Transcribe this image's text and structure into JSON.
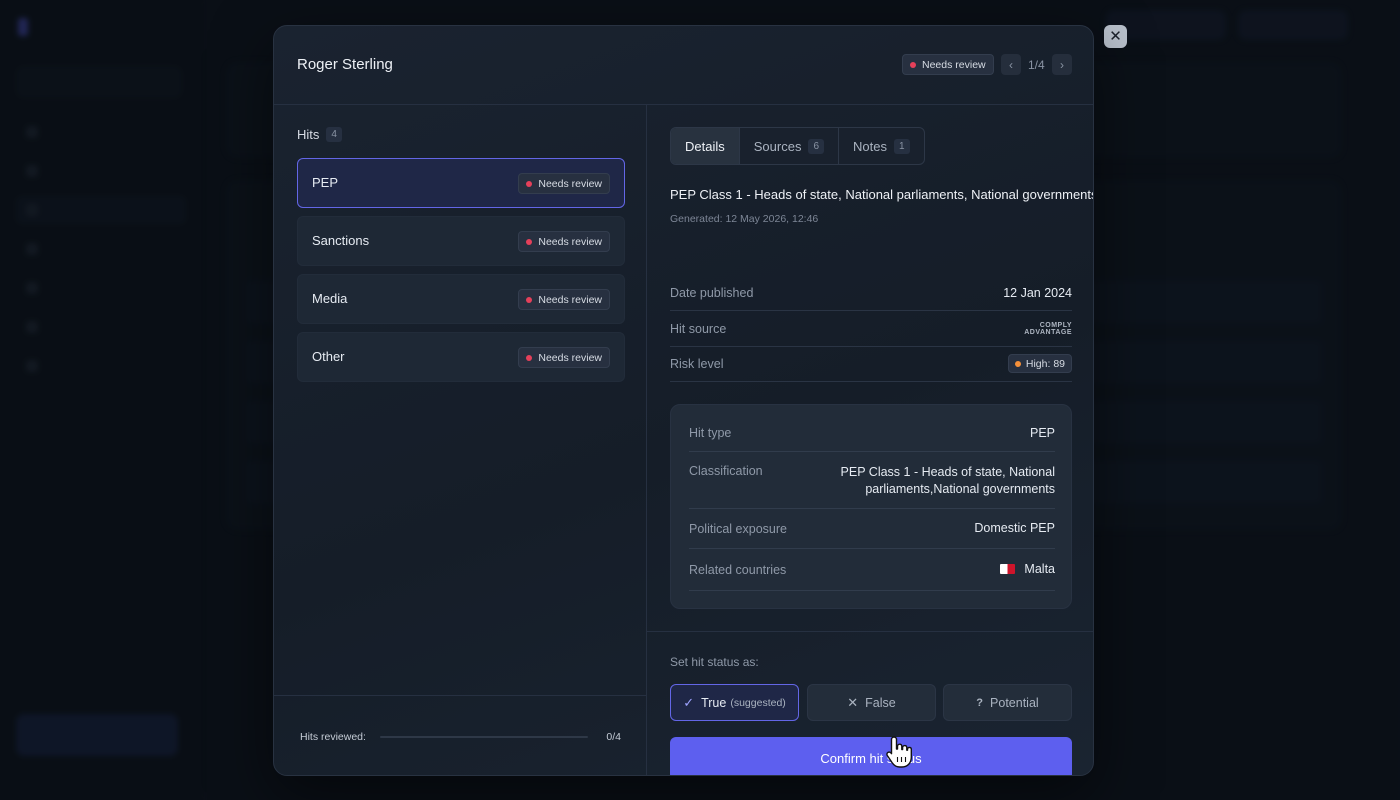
{
  "modal": {
    "title": "Roger Sterling",
    "status": "Needs review",
    "pager": "1/4",
    "close_icon": "close-icon"
  },
  "hits": {
    "label": "Hits",
    "count": "4",
    "items": [
      {
        "name": "PEP",
        "status": "Needs review",
        "selected": true
      },
      {
        "name": "Sanctions",
        "status": "Needs review",
        "selected": false
      },
      {
        "name": "Media",
        "status": "Needs review",
        "selected": false
      },
      {
        "name": "Other",
        "status": "Needs review",
        "selected": false
      }
    ],
    "reviewed_label": "Hits reviewed:",
    "reviewed_count": "0/4",
    "reviewed_fraction": 0
  },
  "tabs": [
    {
      "label": "Details",
      "count": ""
    },
    {
      "label": "Sources",
      "count": "6"
    },
    {
      "label": "Notes",
      "count": "1"
    }
  ],
  "details": {
    "heading": "PEP Class 1 - Heads of state, National parliaments, National governments",
    "generated": "Generated: 12 May 2026, 12:46",
    "rows": [
      {
        "key": "Date published",
        "value": "12 Jan 2024"
      },
      {
        "key": "Hit source",
        "value": "COMPLY ADVANTAGE"
      },
      {
        "key": "Risk level",
        "value": "High: 89"
      }
    ],
    "card": [
      {
        "key": "Hit type",
        "value": "PEP"
      },
      {
        "key": "Classification",
        "value": "PEP Class 1 - Heads of state, National parliaments,National governments"
      },
      {
        "key": "Political exposure",
        "value": "Domestic PEP"
      },
      {
        "key": "Related countries",
        "value": "Malta"
      }
    ]
  },
  "status_form": {
    "label": "Set hit status as:",
    "options": [
      {
        "label": "True",
        "sub": "(suggested)",
        "icon": "check-icon",
        "selected": true
      },
      {
        "label": "False",
        "sub": "",
        "icon": "x-icon",
        "selected": false
      },
      {
        "label": "Potential",
        "sub": "",
        "icon": "question-icon",
        "selected": false
      }
    ],
    "confirm_label": "Confirm hit status"
  },
  "colors": {
    "accent": "#5d5fef",
    "needs_review": "#e5405a",
    "risk_high": "#f5903a"
  }
}
